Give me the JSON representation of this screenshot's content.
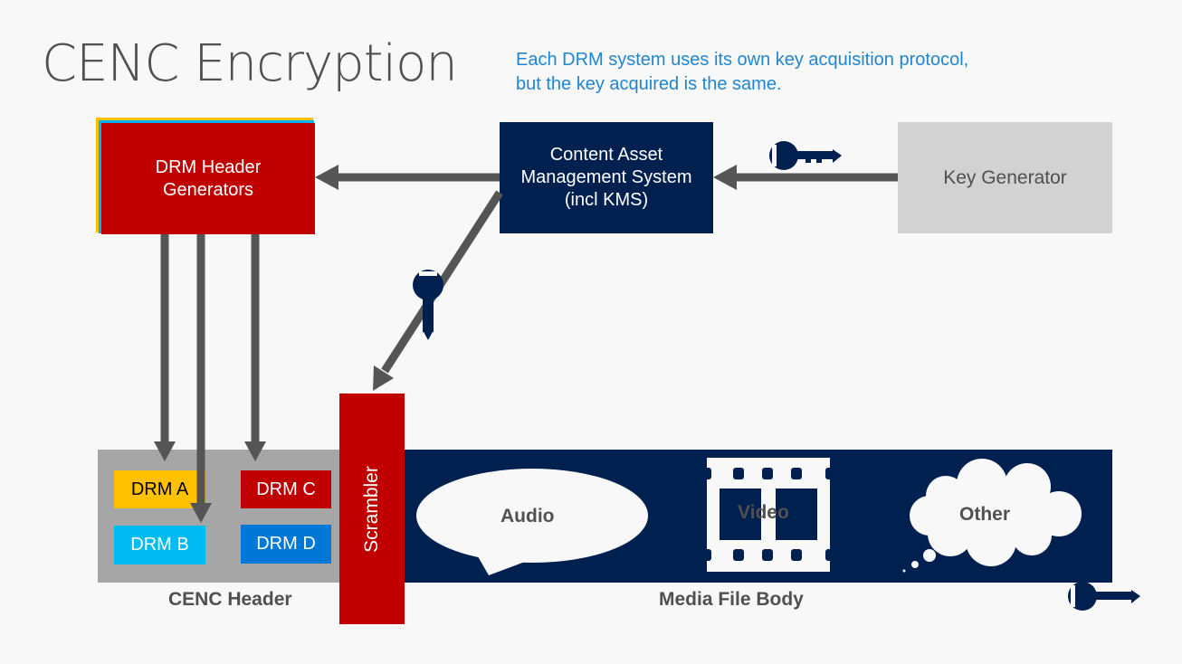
{
  "title": "CENC Encryption",
  "subtitle": {
    "line1": "Each DRM system uses its own key acquisition protocol,",
    "line2": "but the key acquired is the same."
  },
  "nodes": {
    "drm_header_generators": {
      "line1": "DRM Header",
      "line2": "Generators"
    },
    "content_asset_management": {
      "line1": "Content Asset",
      "line2": "Management System",
      "line3": "(incl KMS)"
    },
    "key_generator": "Key Generator",
    "scrambler": "Scrambler"
  },
  "cenc_header": {
    "label": "CENC Header",
    "drm_systems": [
      {
        "label": "DRM A",
        "color": "#ffc000"
      },
      {
        "label": "DRM B",
        "color": "#00bcf2"
      },
      {
        "label": "DRM C",
        "color": "#c00000"
      },
      {
        "label": "DRM D",
        "color": "#0078d7"
      }
    ]
  },
  "media_file_body": {
    "label": "Media File Body",
    "tracks": [
      "Audio",
      "Video",
      "Other"
    ]
  },
  "icons": [
    "key-icon",
    "speech-bubble-icon",
    "film-strip-icon",
    "thought-cloud-icon",
    "arrow-icon"
  ],
  "colors": {
    "background": "#f8f8f8",
    "navy": "#002050",
    "red": "#c00000",
    "arrow": "#555555",
    "subtitle": "#2185d0",
    "key_generator": "#d2d2d2",
    "header_area": "#a6a6a6"
  }
}
